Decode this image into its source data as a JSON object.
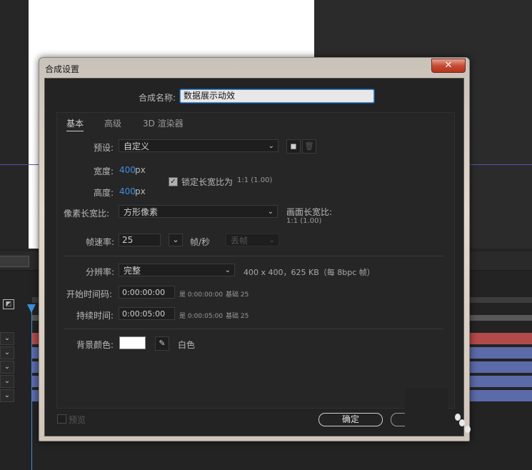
{
  "dialog": {
    "title": "合成设置",
    "close_glyph": "✕",
    "name_label": "合成名称:",
    "name_value": "数据展示动效",
    "tabs": [
      "基本",
      "高级",
      "3D 渲染器"
    ],
    "preset": {
      "label": "预设:",
      "value": "自定义"
    },
    "width": {
      "label": "宽度:",
      "value": "400",
      "unit": "px"
    },
    "height": {
      "label": "高度:",
      "value": "400",
      "unit": "px"
    },
    "lock_aspect": {
      "label": "锁定长宽比为",
      "ratio": "1:1 (1.00)",
      "checked": true
    },
    "pixel_aspect": {
      "label": "像素长宽比:",
      "value": "方形像素"
    },
    "frame_aspect": {
      "label": "画面长宽比:",
      "value": "1:1 (1.00)"
    },
    "frame_rate": {
      "label": "帧速率:",
      "value": "25",
      "unit": "帧/秒",
      "drop_frame": "丢帧"
    },
    "resolution": {
      "label": "分辨率:",
      "value": "完整",
      "info": "400 x 400，625 KB（每 8bpc 帧）"
    },
    "start_timecode": {
      "label": "开始时间码:",
      "value": "0:00:00:00",
      "info": "是 0:00:00:00",
      "base": "基础 25"
    },
    "duration": {
      "label": "持续时间:",
      "value": "0:00:05:00",
      "info": "是 0:00:05:00",
      "base": "基础 25"
    },
    "background_color": {
      "label": "背景颜色:",
      "name": "白色",
      "hex": "#ffffff"
    },
    "preview_label": "预览",
    "ok_label": "确定"
  },
  "icons": [
    "close-icon",
    "new-preset-icon",
    "delete-preset-icon",
    "chevron-down-icon",
    "eyedropper-icon",
    "comp-icon",
    "playhead-icon"
  ],
  "colors": {
    "accent": "#3d8fe0",
    "layer_red": "#b34a4a",
    "layer_blue": "#5b6aa8"
  }
}
